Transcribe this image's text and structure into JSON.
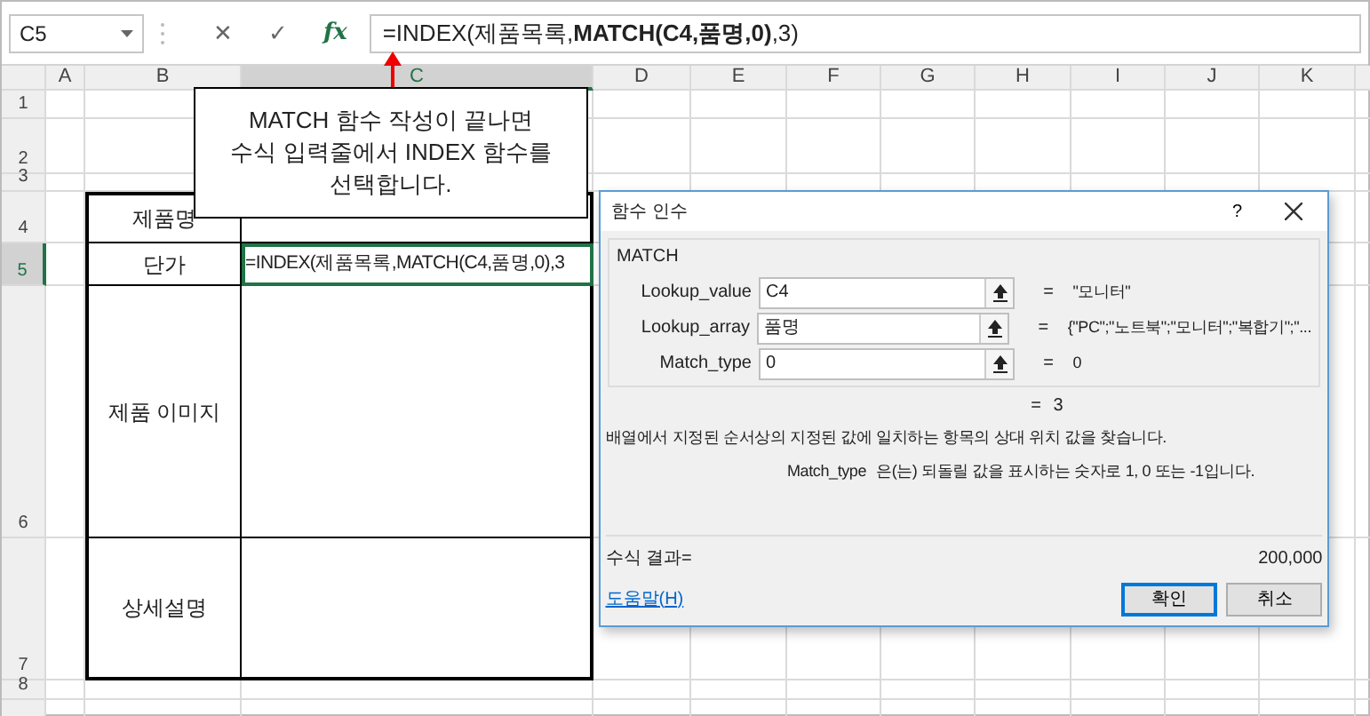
{
  "name_box": "C5",
  "formula_bar": {
    "cancel": "✕",
    "enter": "✓",
    "function": "fx",
    "formula": "=INDEX(제품목록,**MATCH(C4,품명,0)**,3)"
  },
  "columns": [
    {
      "label": "A",
      "selected": false
    },
    {
      "label": "B",
      "selected": false
    },
    {
      "label": "C",
      "selected": true
    },
    {
      "label": "D",
      "selected": false
    },
    {
      "label": "E",
      "selected": false
    },
    {
      "label": "F",
      "selected": false
    },
    {
      "label": "G",
      "selected": false
    },
    {
      "label": "H",
      "selected": false
    },
    {
      "label": "I",
      "selected": false
    },
    {
      "label": "J",
      "selected": false
    },
    {
      "label": "K",
      "selected": false
    }
  ],
  "rows": [
    {
      "label": "1",
      "selected": false
    },
    {
      "label": "2",
      "selected": false
    },
    {
      "label": "3",
      "selected": false
    },
    {
      "label": "4",
      "selected": false
    },
    {
      "label": "5",
      "selected": true
    },
    {
      "label": "6",
      "selected": false
    },
    {
      "label": "7",
      "selected": false
    },
    {
      "label": "8",
      "selected": false
    }
  ],
  "table": [
    {
      "label": "제품명",
      "selected": false
    },
    {
      "label": "단가",
      "value": "=INDEX(제품목록,MATCH(C4,품명,0),3",
      "selected": true
    },
    {
      "label": "제품 이미지",
      "selected": false
    },
    {
      "label": "상세설명",
      "selected": false
    }
  ],
  "callout": {
    "text": "MATCH 함수 작성이 끝나면\n수식 입력줄에서 INDEX 함수를\n선택합니다."
  },
  "dialog": {
    "title": "함수 인수",
    "help": "?",
    "group": "MATCH",
    "arguments": [
      {
        "label": "Lookup_value",
        "value": "C4",
        "eq": "=",
        "result": "\"모니터\""
      },
      {
        "label": "Lookup_array",
        "value": "품명",
        "eq": "=",
        "result": "{\"PC\";\"노트북\";\"모니터\";\"복합기\";\"..."
      },
      {
        "label": "Match_type",
        "value": "0",
        "eq": "=",
        "result": "0"
      }
    ],
    "total": {
      "eq": "=",
      "value": "3"
    },
    "description": "배열에서 지정된 순서상의 지정된 값에 일치하는 항목의 상대 위치 값을 찾습니다.",
    "arg_help": {
      "name": "Match_type",
      "text": "은(는) 되돌릴 값을 표시하는 숫자로 1, 0 또는 -1입니다."
    },
    "formula_result": {
      "label": "수식 결과=",
      "value": "200,000"
    },
    "help_link": "도움말(H)",
    "buttons": [
      {
        "label": "확인",
        "default": true
      },
      {
        "label": "취소",
        "default": false
      }
    ]
  }
}
